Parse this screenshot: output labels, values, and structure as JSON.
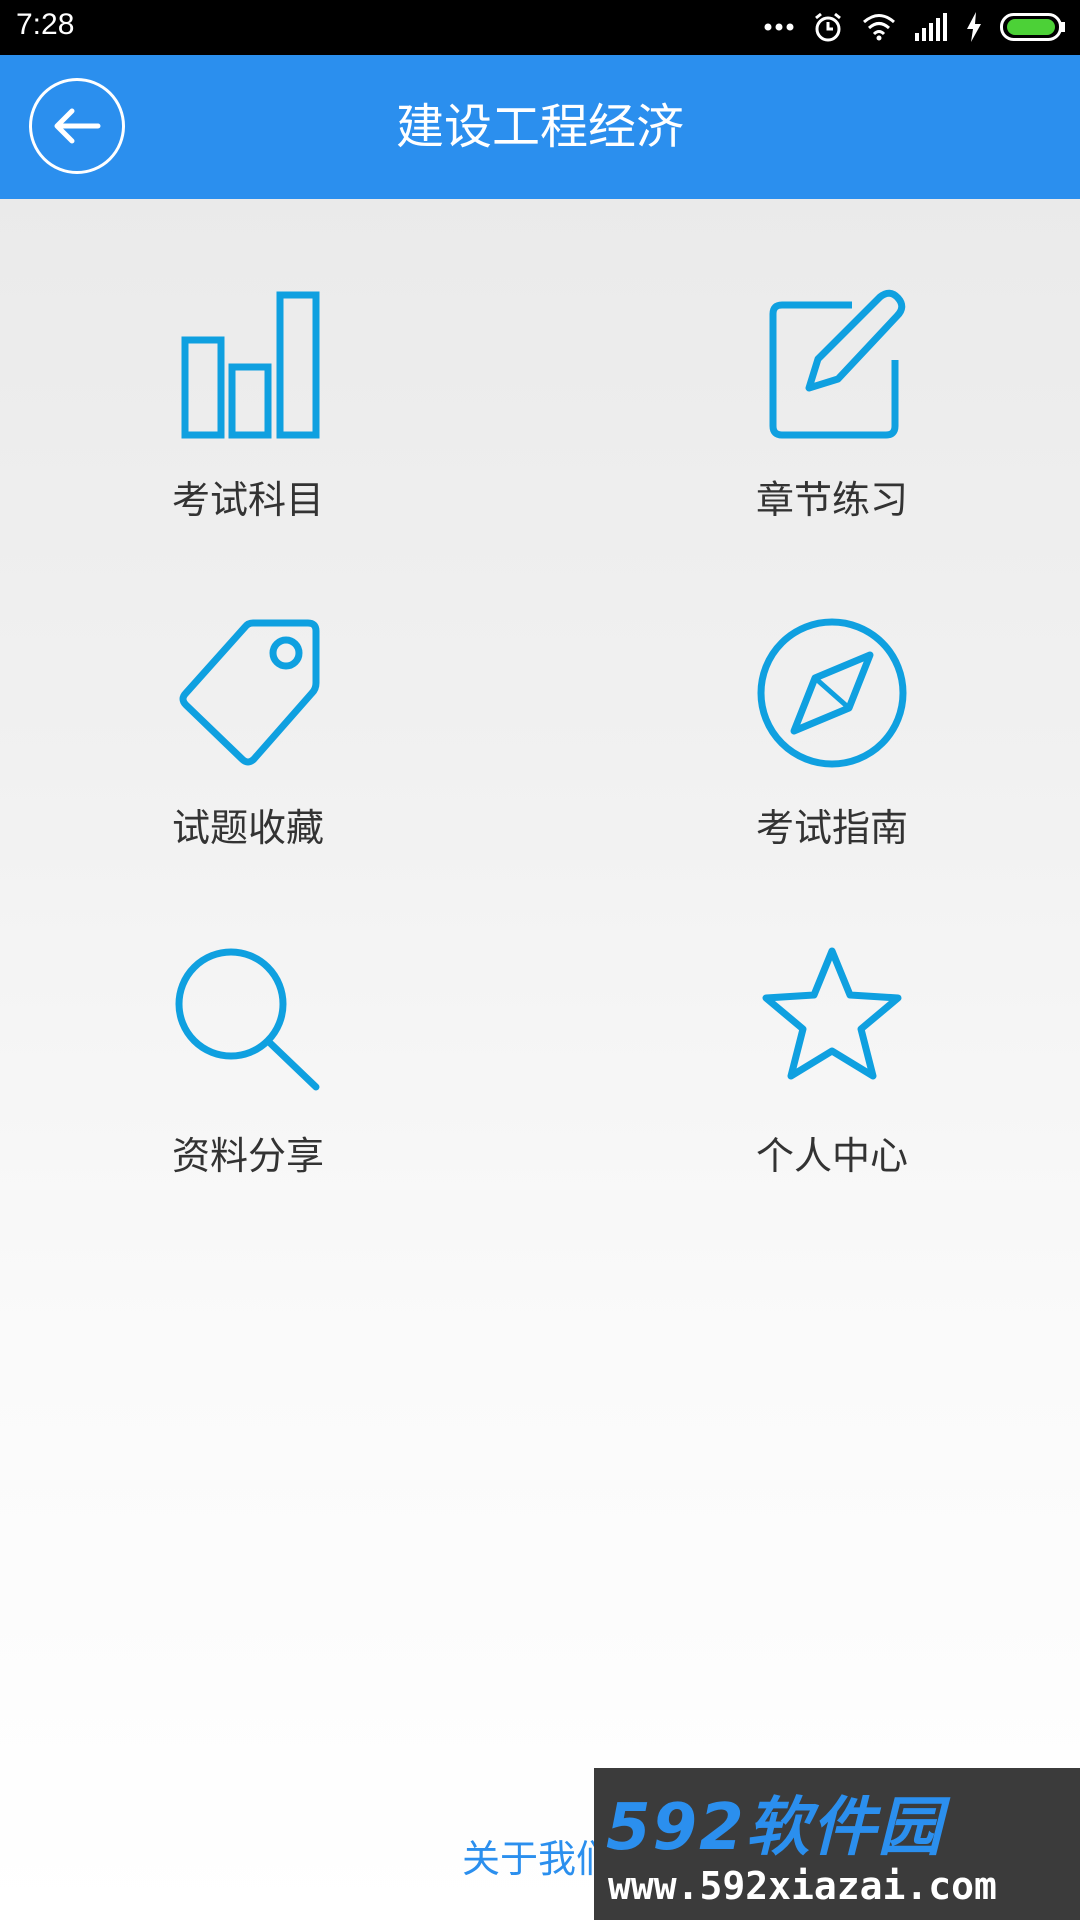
{
  "status_bar": {
    "time": "7:28"
  },
  "header": {
    "title": "建设工程经济"
  },
  "menu": [
    {
      "label": "考试科目",
      "icon": "bar-chart-icon"
    },
    {
      "label": "章节练习",
      "icon": "edit-icon"
    },
    {
      "label": "试题收藏",
      "icon": "tag-icon"
    },
    {
      "label": "考试指南",
      "icon": "compass-icon"
    },
    {
      "label": "资料分享",
      "icon": "search-icon"
    },
    {
      "label": "个人中心",
      "icon": "star-icon"
    }
  ],
  "footer": {
    "about_label": "关于我们"
  },
  "watermark": {
    "brand": "592软件园",
    "url": "www.592xiazai.com"
  },
  "colors": {
    "accent": "#2b8fee",
    "icon": "#0fa0e0",
    "status_bar": "#000000",
    "battery": "#4cd137"
  }
}
